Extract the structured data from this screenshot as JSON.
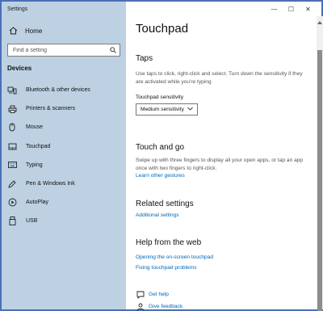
{
  "window": {
    "title": "Settings"
  },
  "titlebar": {
    "minimize_glyph": "—",
    "maximize_glyph": "☐",
    "close_glyph": "✕"
  },
  "sidebar": {
    "home_label": "Home",
    "search_placeholder": "Find a setting",
    "section_label": "Devices",
    "items": [
      {
        "label": "Bluetooth & other devices",
        "icon": "bluetooth-icon"
      },
      {
        "label": "Printers & scanners",
        "icon": "printer-icon"
      },
      {
        "label": "Mouse",
        "icon": "mouse-icon"
      },
      {
        "label": "Touchpad",
        "icon": "touchpad-icon",
        "selected": true
      },
      {
        "label": "Typing",
        "icon": "keyboard-icon"
      },
      {
        "label": "Pen & Windows Ink",
        "icon": "pen-icon"
      },
      {
        "label": "AutoPlay",
        "icon": "autoplay-icon"
      },
      {
        "label": "USB",
        "icon": "usb-icon"
      }
    ]
  },
  "main": {
    "title": "Touchpad",
    "taps": {
      "heading": "Taps",
      "description": "Use taps to click, right-click and select. Turn down the sensitivity if they are activated while you're typing",
      "sensitivity_label": "Touchpad sensitivity",
      "sensitivity_value": "Medium sensitivity"
    },
    "touch_and_go": {
      "heading": "Touch and go",
      "description": "Swipe up with three fingers to display all your open apps, or tap an app once with two fingers to right-click.",
      "link": "Learn other gestures"
    },
    "related": {
      "heading": "Related settings",
      "link": "Additional settings"
    },
    "help": {
      "heading": "Help from the web",
      "links": [
        "Opening the on-screen touchpad",
        "Fixing touchpad problems"
      ]
    },
    "get_help": "Get help",
    "give_feedback": "Give feedback"
  },
  "colors": {
    "sidebar_bg": "#bdd1e3",
    "link": "#0066b4",
    "border": "#4a6fb5"
  }
}
